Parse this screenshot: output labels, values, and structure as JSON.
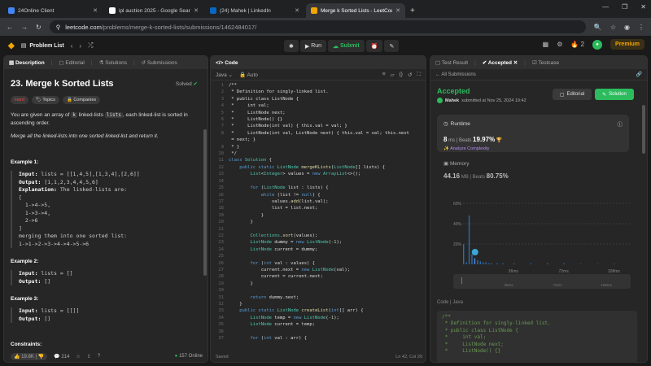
{
  "browser": {
    "tabs": [
      {
        "title": "24Online Client",
        "color": "#4285f4",
        "active": false
      },
      {
        "title": "ipl auction 2025 - Google Sear",
        "color": "#ffffff",
        "active": false
      },
      {
        "title": "(24) Mahek | LinkedIn",
        "color": "#0a66c2",
        "active": false
      },
      {
        "title": "Merge k Sorted Lists - LeetCod",
        "color": "#f0a500",
        "active": true
      }
    ],
    "url_host": "leetcode.com",
    "url_path": "/problems/merge-k-sorted-lists/submissions/1462484017/"
  },
  "nav": {
    "problem_list": "Problem List",
    "run": "Run",
    "submit": "Submit",
    "fire_count": "2",
    "premium": "Premium"
  },
  "left": {
    "tabs": [
      "Description",
      "Editorial",
      "Solutions",
      "Submissions"
    ],
    "title": "23. Merge k Sorted Lists",
    "solved": "Solved",
    "badges": [
      "Hard",
      "Topics",
      "Companies"
    ],
    "desc1_a": "You are given an array of ",
    "desc1_code1": "k",
    "desc1_b": " linked-lists ",
    "desc1_code2": "lists",
    "desc1_c": ", each linked-list is sorted in ascending order.",
    "desc2": "Merge all the linked-lists into one sorted linked-list and return it.",
    "ex1_title": "Example 1:",
    "ex1_input_label": "Input:",
    "ex1_input": " lists = [[1,4,5],[1,3,4],[2,6]]",
    "ex1_output_label": "Output:",
    "ex1_output": " [1,1,2,3,4,4,5,6]",
    "ex1_expl_label": "Explanation:",
    "ex1_expl": " The linked-lists are:",
    "ex1_lines": [
      "[",
      "  1->4->5,",
      "  1->3->4,",
      "  2->6",
      "]",
      "merging them into one sorted list:",
      "1->1->2->3->4->4->5->6"
    ],
    "ex2_title": "Example 2:",
    "ex2_input": " lists = []",
    "ex2_output": " []",
    "ex3_title": "Example 3:",
    "ex3_input": " lists = [[]]",
    "ex3_output": " []",
    "constraints": "Constraints:",
    "likes": "19.8K",
    "comments": "214",
    "online": "157 Online"
  },
  "mid": {
    "header": "Code",
    "lang": "Java",
    "auto": "Auto",
    "saved": "Saved",
    "cursor": "Ln 42, Col 20"
  },
  "right": {
    "tabs": [
      "Test Result",
      "Accepted",
      "Testcase"
    ],
    "all_submissions": "All Submissions",
    "status": "Accepted",
    "user": "Mahek",
    "submitted_at": "submitted at Nov 25, 2024 19:42",
    "editorial": "Editorial",
    "solution": "Solution",
    "runtime_label": "Runtime",
    "runtime_val": "8",
    "runtime_unit": "ms",
    "beats_label": "Beats",
    "runtime_beats": "19.97%",
    "analyze": "Analyze Complexity",
    "memory_label": "Memory",
    "memory_val": "44.16",
    "memory_unit": "MB",
    "memory_beats": "80.75%",
    "y_ticks": [
      "60%",
      "40%",
      "20%"
    ],
    "x_ticks": [
      "36ms",
      "72ms",
      "108ms"
    ],
    "mini_ticks": [
      "36ms",
      "72ms",
      "108ms"
    ],
    "code_label": "Code",
    "code_lang": "Java",
    "code_preview": [
      "/**",
      " * Definition for singly-linked list.",
      " * public class ListNode {",
      " *     int val;",
      " *     ListNode next;",
      " *     ListNode() {}"
    ]
  },
  "chart_data": {
    "type": "bar",
    "x": [
      0,
      2,
      4,
      6,
      8,
      10,
      12,
      14,
      16,
      18,
      20,
      24,
      28,
      36,
      48,
      60,
      72,
      84,
      96,
      108
    ],
    "values": [
      20,
      2,
      48,
      10,
      6,
      4,
      3,
      2,
      2,
      1,
      1,
      1,
      1,
      1,
      1,
      1,
      1,
      0.5,
      0.5,
      0.5
    ],
    "ylim": [
      0,
      60
    ],
    "xlim": [
      0,
      120
    ],
    "highlight_x": 8
  }
}
